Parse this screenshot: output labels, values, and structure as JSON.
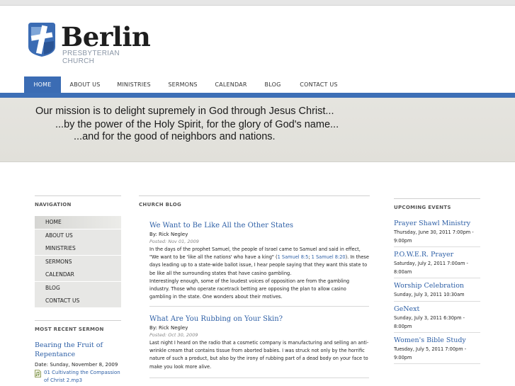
{
  "brand": {
    "name": "Berlin",
    "subtitle": "PRESBYTERIAN CHURCH",
    "colors": {
      "accent": "#3b6cb4",
      "link": "#2d5fa6",
      "mission_bg": "#e3e2dc"
    }
  },
  "nav": {
    "items": [
      {
        "label": "HOME",
        "active": true
      },
      {
        "label": "ABOUT US"
      },
      {
        "label": "MINISTRIES"
      },
      {
        "label": "SERMONS"
      },
      {
        "label": "CALENDAR"
      },
      {
        "label": "BLOG"
      },
      {
        "label": "CONTACT US"
      }
    ]
  },
  "mission": {
    "line1": "Our mission is to delight supremely in God through Jesus Christ...",
    "line2": "...by the power of the Holy Spirit, for the glory of God's name...",
    "line3": "...and for the good of neighbors and nations."
  },
  "sidebar": {
    "nav_title": "NAVIGATION",
    "items": [
      {
        "label": "HOME",
        "active": true
      },
      {
        "label": "ABOUT US"
      },
      {
        "label": "MINISTRIES"
      },
      {
        "label": "SERMONS"
      },
      {
        "label": "CALENDAR"
      },
      {
        "label": "BLOG"
      },
      {
        "label": "CONTACT US"
      }
    ],
    "sermon_title": "MOST RECENT SERMON",
    "sermon": {
      "title": "Bearing the Fruit of Repentance",
      "date": "Date: Sunday, November 8, 2009",
      "file": "01 Cultivating the Compassion of Christ 2.mp3"
    }
  },
  "blog": {
    "title": "CHURCH BLOG",
    "posts": [
      {
        "title": "We Want to Be Like All the Other States",
        "by": "By: Rick Negley",
        "posted": "Posted: Nov 01, 2009",
        "body_1": "In the days of the prophet Samuel, the people of Israel came to Samuel and said in effect, \"We want to be 'like all the nations' who have a king\" (",
        "ref1": "1 Samuel 8:5",
        "sep": "; ",
        "ref2": "1 Samuel 8:20",
        "body_2": "). In these days leading up to a state-wide ballot issue, I hear people saying that they want this state to be like all the surrounding states that have casino gambling.",
        "body_3": "Interestingly enough, some of the loudest voices of opposition are from the gambling industry. Those who operate racetrack betting are opposing the plan to allow casino gambling in the state. One wonders about their motives."
      },
      {
        "title": "What Are You Rubbing on Your Skin?",
        "by": "By: Rick Negley",
        "posted": "Posted: Oct 30, 2009",
        "body_1": "Last night I heard on the radio that a cosmetic company is manufacturing and selling an anti-wrinkle cream that contains tissue from aborted babies. I was struck not only by the horrific nature of such a product, but also by the irony of rubbing part of a dead body on your face to make you look more alive."
      }
    ]
  },
  "events": {
    "title": "UPCOMING EVENTS",
    "items": [
      {
        "title": "Prayer Shawl Ministry",
        "date": "Thursday, June 30, 2011 7:00pm - 9:00pm"
      },
      {
        "title": "P.O.W.E.R. Prayer",
        "date": "Saturday, July 2, 2011 7:00am - 8:00am"
      },
      {
        "title": "Worship Celebration",
        "date": "Sunday, July 3, 2011 10:30am"
      },
      {
        "title": "GeNext",
        "date": "Sunday, July 3, 2011 6:30pm - 8:00pm"
      },
      {
        "title": "Women's Bible Study",
        "date": "Tuesday, July 5, 2011 7:00pm - 9:00pm"
      }
    ]
  }
}
